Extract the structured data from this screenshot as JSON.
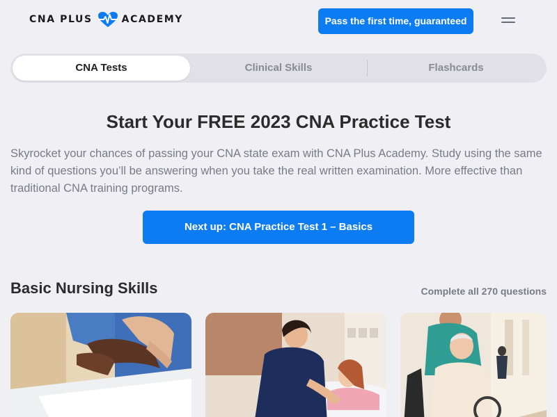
{
  "header": {
    "logo_left": "CNA PLUS",
    "logo_right": "ACADEMY",
    "cta_label": "Pass the first time, guaranteed",
    "menu_icon": "hamburger-icon"
  },
  "tabs": [
    {
      "label": "CNA Tests",
      "active": true
    },
    {
      "label": "Clinical Skills",
      "active": false
    },
    {
      "label": "Flashcards",
      "active": false
    }
  ],
  "main": {
    "title": "Start Your FREE 2023 CNA Practice Test",
    "intro": "Skyrocket your chances of passing your CNA state exam with CNA Plus Academy. Study using the same kind of questions you’ll be answering when you take the real written examination. More effective than traditional CNA training programs.",
    "next_button": "Next up: CNA Practice Test 1 – Basics"
  },
  "section": {
    "title": "Basic Nursing Skills",
    "link": "Complete all 270 questions"
  },
  "colors": {
    "accent": "#0d7cf2",
    "background": "#f0f0f4",
    "tab_bar": "#e0e0e6"
  }
}
